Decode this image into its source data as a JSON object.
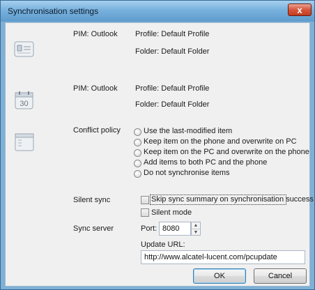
{
  "window": {
    "title": "Synchronisation settings",
    "close_label": "x"
  },
  "sections": [
    {
      "pim_label": "PIM: Outlook",
      "profile": "Profile: Default Profile",
      "folder": "Folder: Default Folder"
    },
    {
      "pim_label": "PIM: Outlook",
      "profile": "Profile: Default Profile",
      "folder": "Folder: Default Folder",
      "calendar_day": "30"
    }
  ],
  "conflict": {
    "label": "Conflict policy",
    "options": [
      "Use the last-modified item",
      "Keep item on the phone and overwrite on PC",
      "Keep item on the PC and overwrite on the phone",
      "Add items to both PC and the phone",
      "Do not synchronise items"
    ]
  },
  "silent_sync": {
    "label": "Silent sync",
    "skip_summary": "Skip sync summary on synchronisation success",
    "silent_mode": "Silent mode"
  },
  "sync_server": {
    "label": "Sync server",
    "port_label": "Port:",
    "port_value": "8080",
    "update_url_label": "Update URL:",
    "update_url_value": "http://www.alcatel-lucent.com/pcupdate"
  },
  "buttons": {
    "ok": "OK",
    "cancel": "Cancel"
  }
}
